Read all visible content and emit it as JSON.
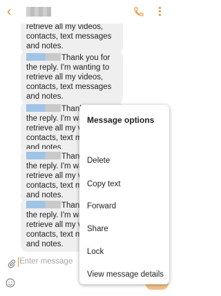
{
  "header": {
    "back_icon": "chevron-left-icon",
    "phone_icon": "phone-icon",
    "more_icon": "more-vertical-icon",
    "accent": "#f08a28"
  },
  "messages": [
    {
      "text": "retrieve all my videos, contacts, text messages and notes."
    },
    {
      "text": "Thank you for the reply. I'm wanting to retrieve all my videos, contacts, text messages and notes."
    },
    {
      "text": "Thank you for the reply. I'm wanting to retrieve all my videos, contacts, text messages and notes."
    },
    {
      "text": "Thank you for the reply. I'm wanting to retrieve all my videos, contacts, text messages and notes."
    },
    {
      "text": "Thank you for the reply. I'm wanting to retrieve all my videos, contacts, text messages and notes."
    }
  ],
  "menu": {
    "title": "Message options",
    "items": [
      "Delete",
      "Copy text",
      "Forward",
      "Share",
      "Lock",
      "View message details"
    ]
  },
  "composer": {
    "placeholder": "Enter message",
    "attach_icon": "paperclip-icon",
    "emoji_icon": "emoji-icon"
  }
}
